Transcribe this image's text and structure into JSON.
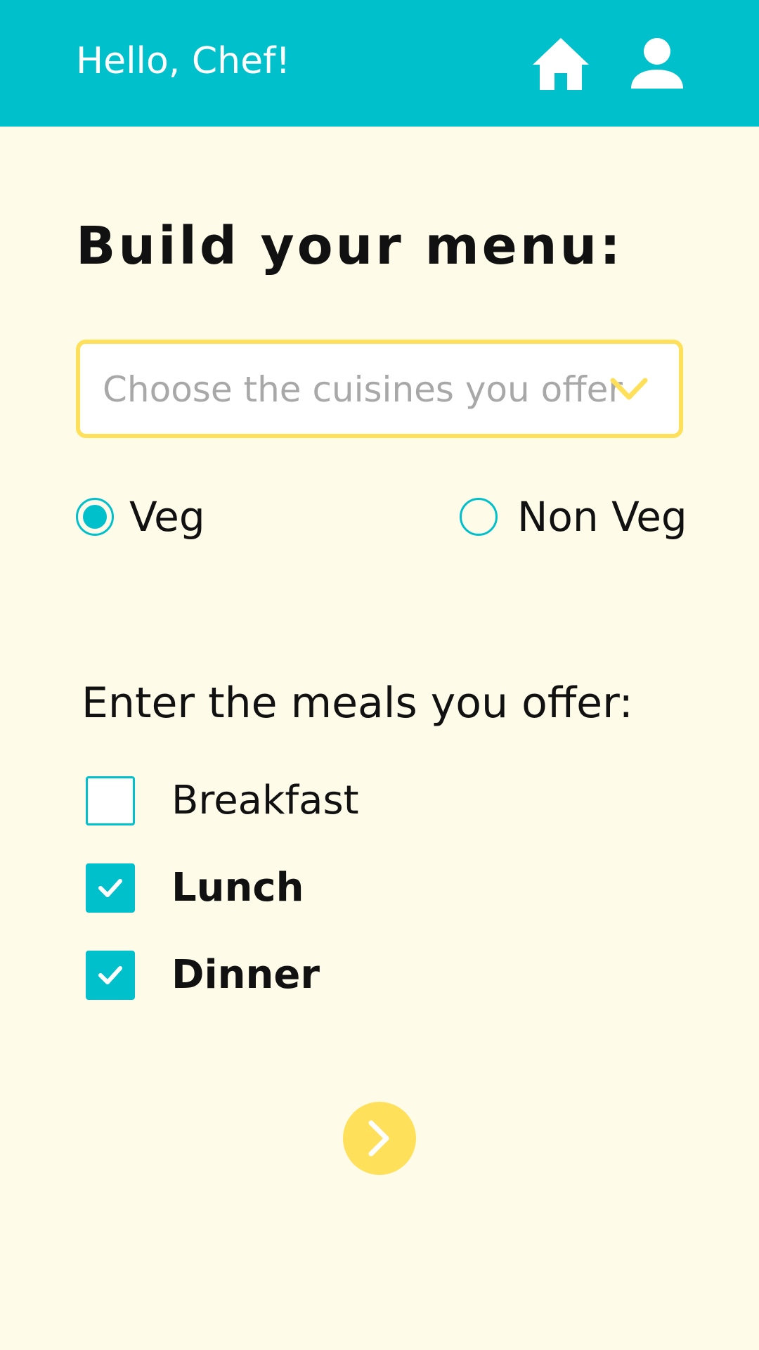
{
  "header": {
    "greeting": "Hello, Chef!",
    "home_icon": "home-icon",
    "profile_icon": "user-profile-icon"
  },
  "main": {
    "title": "Build your menu:",
    "cuisine_select": {
      "placeholder": "Choose the cuisines you offer",
      "icon": "chevron-down-icon"
    },
    "diet_options": [
      {
        "label": "Veg",
        "selected": true
      },
      {
        "label": "Non Veg",
        "selected": false
      }
    ],
    "meals_heading": "Enter the meals you offer:",
    "meals": [
      {
        "label": "Breakfast",
        "checked": false
      },
      {
        "label": "Lunch",
        "checked": true
      },
      {
        "label": "Dinner",
        "checked": true
      }
    ],
    "next_icon": "chevron-right-icon"
  },
  "colors": {
    "primary": "#00C1CB",
    "accent": "#FFE05A",
    "background": "#FEFBE9",
    "placeholder_text": "#A8A8A8"
  }
}
